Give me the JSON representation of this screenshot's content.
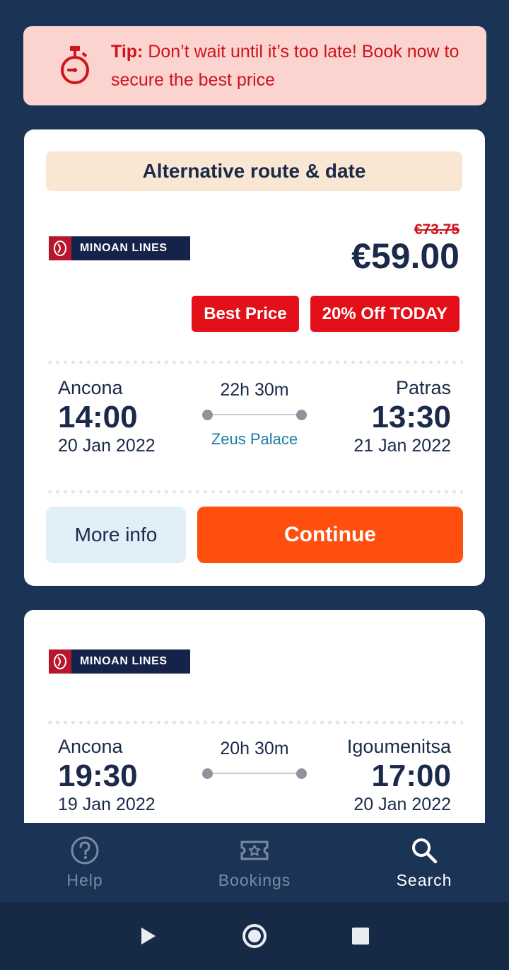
{
  "tip": {
    "label": "Tip:",
    "text": " Don’t wait until it’s too late! Book now to secure the best price"
  },
  "card1": {
    "banner": "Alternative route & date",
    "operator": "MINOAN LINES",
    "price_old": "€73.75",
    "price_new": "€59.00",
    "badges": [
      "Best Price",
      "20% Off TODAY"
    ],
    "departure": {
      "city": "Ancona",
      "time": "14:00",
      "date": "20 Jan 2022"
    },
    "arrival": {
      "city": "Patras",
      "time": "13:30",
      "date": "21 Jan 2022"
    },
    "duration": "22h 30m",
    "vessel": "Zeus Palace",
    "more_info": "More info",
    "continue": "Continue"
  },
  "card2": {
    "operator": "MINOAN LINES",
    "departure": {
      "city": "Ancona",
      "time": "19:30",
      "date": "19 Jan 2022"
    },
    "arrival": {
      "city": "Igoumenitsa",
      "time": "17:00",
      "date": "20 Jan 2022"
    },
    "duration": "20h 30m"
  },
  "nav": {
    "items": [
      {
        "label": "Help",
        "icon": "help-icon",
        "active": false
      },
      {
        "label": "Bookings",
        "icon": "ticket-icon",
        "active": false
      },
      {
        "label": "Search",
        "icon": "search-icon",
        "active": true
      }
    ]
  },
  "colors": {
    "background": "#1b3456",
    "accent_orange": "#ff4f0f",
    "badge_red": "#e3101a",
    "tip_bg": "#fbd3cf",
    "vessel_blue": "#1e7ba6"
  }
}
